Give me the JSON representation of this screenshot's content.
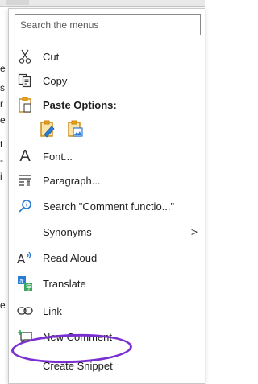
{
  "search": {
    "placeholder": "Search the menus"
  },
  "menu": {
    "cut": "Cut",
    "copy": "Copy",
    "paste_options": "Paste Options:",
    "font": "Font...",
    "paragraph": "Paragraph...",
    "search_item": "Search \"Comment functio...\"",
    "synonyms": "Synonyms",
    "synonyms_arrow": ">",
    "read_aloud": "Read Aloud",
    "translate": "Translate",
    "link": "Link",
    "new_comment": "New Comment",
    "create_snippet": "Create Snippet"
  },
  "colors": {
    "accent_blue": "#2b7cd3",
    "annotation_purple": "#7a2fd0",
    "paste_yellow": "#e8a317"
  },
  "doc_fragments": [
    "e",
    "s",
    "r",
    "e",
    "t",
    "-",
    "i",
    "e"
  ]
}
